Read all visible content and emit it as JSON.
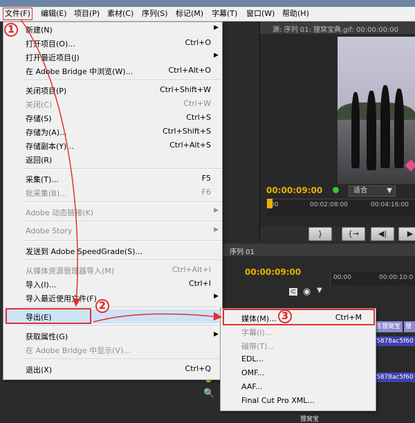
{
  "menubar": {
    "items": [
      "文件(F)",
      "编辑(E)",
      "项目(P)",
      "素材(C)",
      "序列(S)",
      "标记(M)",
      "字幕(T)",
      "窗口(W)",
      "帮助(H)"
    ]
  },
  "source_panel": {
    "tab": "源: 序列 01: 狸窝宝典.gif: 00:00:00:00",
    "timecode": "00:00:09:00",
    "fit": "适合",
    "ruler_ticks": [
      ":00",
      "00:02:08:00",
      "00:04:16:00"
    ],
    "buttons": [
      "}",
      "{→",
      "◀|",
      "▶"
    ]
  },
  "sequence_panel": {
    "tab": "序列 01",
    "timecode": "00:00:09:00",
    "ruler_ticks": [
      "00:00",
      "00:00:10:0"
    ],
    "clips": [
      "狸窝宝",
      "狸窝宝",
      "狸"
    ],
    "clip_ids": [
      "5878ac5f60",
      "5878ac5f60"
    ],
    "bottom_tab": "狸窝宝"
  },
  "file_menu": {
    "items": [
      {
        "label": "新建(N)",
        "shortcut": "",
        "arrow": true,
        "disabled": false
      },
      {
        "label": "打开项目(O)...",
        "shortcut": "Ctrl+O",
        "arrow": false,
        "disabled": false
      },
      {
        "label": "打开最近项目(J)",
        "shortcut": "",
        "arrow": true,
        "disabled": false
      },
      {
        "label": "在 Adobe Bridge 中浏览(W)...",
        "shortcut": "Ctrl+Alt+O",
        "arrow": false,
        "disabled": false
      },
      {
        "label": "关闭项目(P)",
        "shortcut": "Ctrl+Shift+W",
        "arrow": false,
        "disabled": false
      },
      {
        "label": "关闭(C)",
        "shortcut": "Ctrl+W",
        "arrow": false,
        "disabled": true
      },
      {
        "label": "存储(S)",
        "shortcut": "Ctrl+S",
        "arrow": false,
        "disabled": false
      },
      {
        "label": "存储为(A)...",
        "shortcut": "Ctrl+Shift+S",
        "arrow": false,
        "disabled": false
      },
      {
        "label": "存储副本(Y)...",
        "shortcut": "Ctrl+Alt+S",
        "arrow": false,
        "disabled": false
      },
      {
        "label": "返回(R)",
        "shortcut": "",
        "arrow": false,
        "disabled": false
      },
      {
        "label": "采集(T)...",
        "shortcut": "F5",
        "arrow": false,
        "disabled": false
      },
      {
        "label": "批采集(B)...",
        "shortcut": "F6",
        "arrow": false,
        "disabled": true
      },
      {
        "label": "Adobe 动态链接(K)",
        "shortcut": "",
        "arrow": true,
        "disabled": true
      },
      {
        "label": "Adobe Story",
        "shortcut": "",
        "arrow": true,
        "disabled": true
      },
      {
        "label": "发送到 Adobe SpeedGrade(S)...",
        "shortcut": "",
        "arrow": false,
        "disabled": false
      },
      {
        "label": "从媒体资源管理器导入(M)",
        "shortcut": "Ctrl+Alt+I",
        "arrow": false,
        "disabled": true
      },
      {
        "label": "导入(I)...",
        "shortcut": "Ctrl+I",
        "arrow": false,
        "disabled": false
      },
      {
        "label": "导入最近使用文件(F)",
        "shortcut": "",
        "arrow": true,
        "disabled": false
      },
      {
        "label": "导出(E)",
        "shortcut": "",
        "arrow": true,
        "disabled": false
      },
      {
        "label": "获取属性(G)",
        "shortcut": "",
        "arrow": true,
        "disabled": false
      },
      {
        "label": "在 Adobe Bridge 中显示(V)...",
        "shortcut": "",
        "arrow": false,
        "disabled": true
      },
      {
        "label": "退出(X)",
        "shortcut": "Ctrl+Q",
        "arrow": false,
        "disabled": false
      }
    ]
  },
  "export_submenu": {
    "items": [
      {
        "label": "媒体(M)...",
        "shortcut": "Ctrl+M",
        "disabled": false
      },
      {
        "label": "字幕(I)...",
        "shortcut": "",
        "disabled": true
      },
      {
        "label": "磁带(T)...",
        "shortcut": "",
        "disabled": true
      },
      {
        "label": "EDL...",
        "shortcut": "",
        "disabled": false
      },
      {
        "label": "OMF...",
        "shortcut": "",
        "disabled": false
      },
      {
        "label": "AAF...",
        "shortcut": "",
        "disabled": false
      },
      {
        "label": "Final Cut Pro XML...",
        "shortcut": "",
        "disabled": false
      }
    ]
  },
  "annotations": {
    "step1": "1",
    "step2": "2",
    "step3": "3",
    "highlight_color": "#e03030"
  }
}
